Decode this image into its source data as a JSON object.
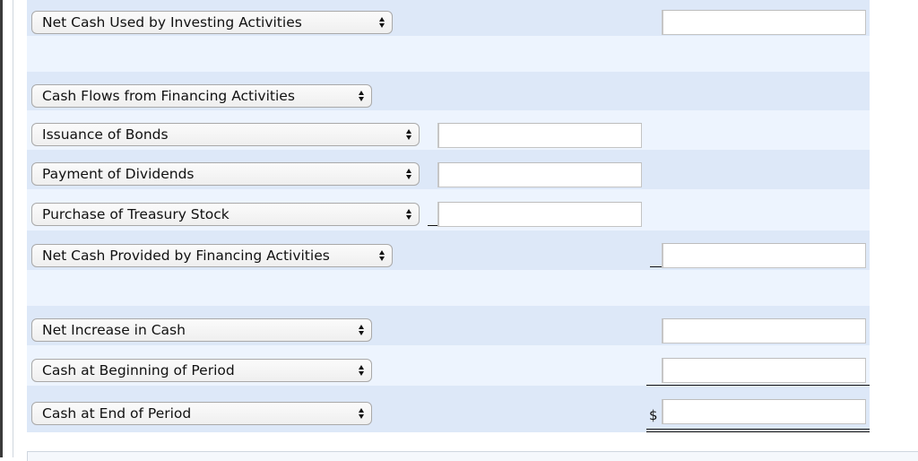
{
  "statement": {
    "rows": [
      {
        "label": "Net Cash Used by Investing Activities"
      },
      {
        "label": "Cash Flows from Financing Activities"
      },
      {
        "label": "Issuance of Bonds"
      },
      {
        "label": "Payment of Dividends"
      },
      {
        "label": "Purchase of Treasury Stock"
      },
      {
        "label": "Net Cash Provided by Financing Activities"
      },
      {
        "label": "Net Increase in Cash"
      },
      {
        "label": "Cash at Beginning of Period"
      },
      {
        "label": "Cash at End of Period"
      }
    ],
    "inputs": {
      "net_cash_investing": "",
      "issuance_of_bonds": "",
      "payment_of_dividends": "",
      "purchase_of_treasury_stock": "",
      "net_cash_financing": "",
      "net_increase_in_cash": "",
      "cash_beginning": "",
      "cash_end": ""
    },
    "currency_symbol": "$"
  },
  "colors": {
    "row_dark": "#dde8f8",
    "row_light": "#edf4fe"
  }
}
